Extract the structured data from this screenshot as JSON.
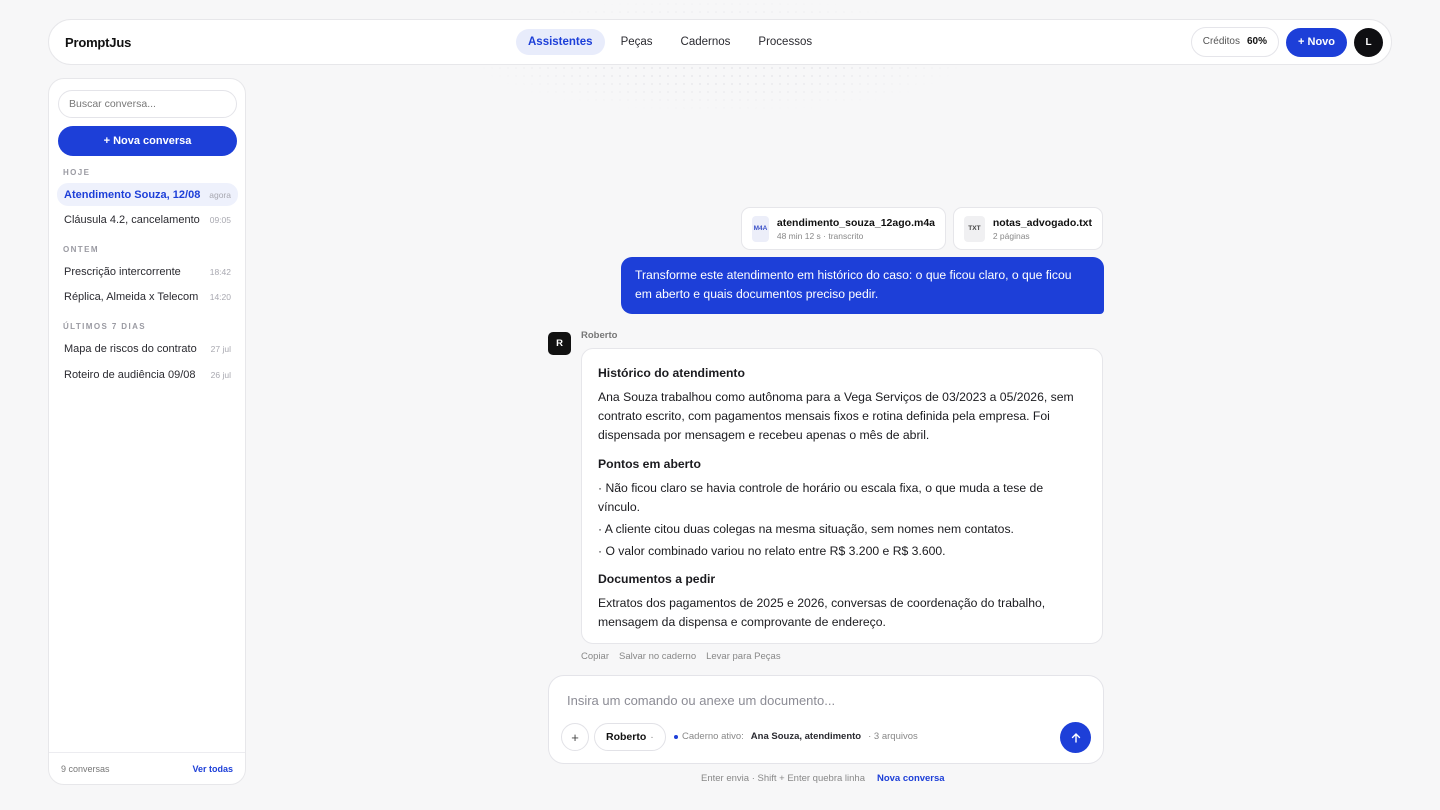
{
  "app": {
    "brand": "PromptJus"
  },
  "nav": {
    "items": [
      "Assistentes",
      "Peças",
      "Cadernos",
      "Processos"
    ],
    "active": "Assistentes"
  },
  "topbar": {
    "credits_label": "Créditos",
    "credits_value": "60%",
    "new_label": "+ Novo",
    "avatar_initial": "L"
  },
  "sidebar": {
    "search_placeholder": "Buscar conversa...",
    "new_conversation": "+ Nova conversa",
    "groups": [
      {
        "label": "HOJE",
        "items": [
          {
            "title": "Atendimento Souza, 12/08",
            "time": "agora",
            "active": true
          },
          {
            "title": "Cláusula 4.2, cancelamento",
            "time": "09:05"
          }
        ]
      },
      {
        "label": "ONTEM",
        "items": [
          {
            "title": "Prescrição intercorrente",
            "time": "18:42"
          },
          {
            "title": "Réplica, Almeida x Telecom",
            "time": "14:20"
          }
        ]
      },
      {
        "label": "ÚLTIMOS 7 DIAS",
        "items": [
          {
            "title": "Mapa de riscos do contrato",
            "time": "27 jul"
          },
          {
            "title": "Roteiro de audiência 09/08",
            "time": "26 jul"
          }
        ]
      }
    ],
    "footer_count": "9 conversas",
    "footer_link": "Ver todas"
  },
  "attachments": [
    {
      "type": "M4A",
      "name": "atendimento_souza_12ago.m4a",
      "meta": "48 min 12 s · transcrito"
    },
    {
      "type": "TXT",
      "name": "notas_advogado.txt",
      "meta": "2 páginas"
    }
  ],
  "user_message": "Transforme este atendimento em histórico do caso: o que ficou claro, o que ficou em aberto e quais documentos preciso pedir.",
  "assistant": {
    "initial": "R",
    "name": "Roberto",
    "sections": {
      "historico_title": "Histórico do atendimento",
      "historico_text": "Ana Souza trabalhou como autônoma para a Vega Serviços de 03/2023 a 05/2026, sem contrato escrito, com pagamentos mensais fixos e rotina definida pela empresa. Foi dispensada por mensagem e recebeu apenas o mês de abril.",
      "pontos_title": "Pontos em aberto",
      "pontos": [
        "· Não ficou claro se havia controle de horário ou escala fixa, o que muda a tese de vínculo.",
        "· A cliente citou duas colegas na mesma situação, sem nomes nem contatos.",
        "· O valor combinado variou no relato entre R$ 3.200 e R$ 3.600."
      ],
      "docs_title": "Documentos a pedir",
      "docs_text": "Extratos dos pagamentos de 2025 e 2026, conversas de coordenação do trabalho, mensagem da dispensa e comprovante de endereço."
    },
    "actions": [
      "Copiar",
      "Salvar no caderno",
      "Levar para Peças"
    ]
  },
  "composer": {
    "placeholder": "Insira um comando ou anexe um documento...",
    "plus": "+",
    "model": "Roberto",
    "model_caret": "·",
    "context_label": "Caderno ativo:",
    "context_value": "Ana Souza, atendimento",
    "context_files": "· 3 arquivos"
  },
  "hint": {
    "text": "Enter envia · Shift + Enter quebra linha",
    "link": "Nova conversa"
  },
  "colors": {
    "accent": "#1d3fd8",
    "background": "#f7f7f8"
  }
}
